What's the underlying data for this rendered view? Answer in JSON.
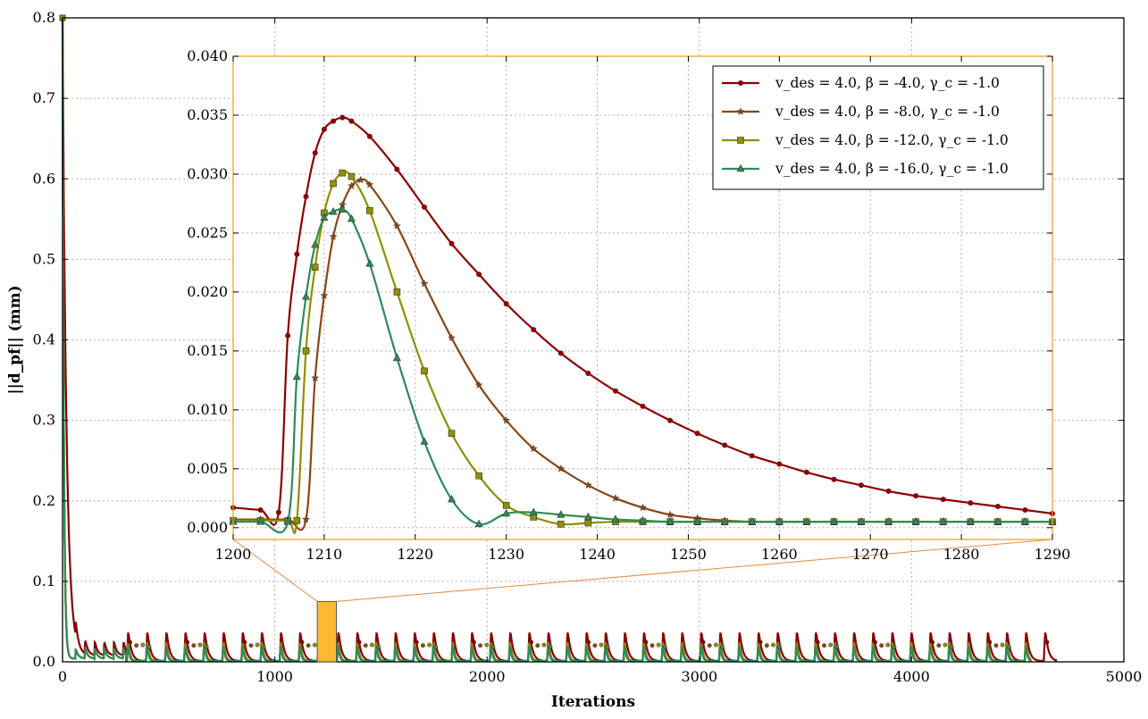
{
  "chart_data": [
    {
      "id": "main",
      "type": "line",
      "title": "",
      "xlabel": "Iterations",
      "ylabel": "||d_pf|| (mm)",
      "xlim": [
        0,
        5000
      ],
      "ylim": [
        0,
        0.8
      ],
      "xticks": [
        "0",
        "1000",
        "2000",
        "3000",
        "4000",
        "5000"
      ],
      "yticks": [
        "0.0",
        "0.1",
        "0.2",
        "0.3",
        "0.4",
        "0.5",
        "0.6",
        "0.7",
        "0.8"
      ],
      "grid": true,
      "initial_value": 0.8,
      "spike_period_iterations": 90,
      "spike_heights": {
        "beta_-4": 0.035,
        "beta_-8": 0.029,
        "beta_-12": 0.03,
        "beta_-16": 0.027
      },
      "zoom_region": {
        "x": [
          1200,
          1290
        ],
        "y": [
          0,
          0.075
        ]
      },
      "series": [
        {
          "name": "v_des = 4.0, β = -4.0, γ_c = -1.0",
          "color": "#8b0000",
          "last_iteration": 4680
        },
        {
          "name": "v_des = 4.0, β = -8.0, γ_c = -1.0",
          "color": "#8b4513",
          "last_iteration": 4560
        },
        {
          "name": "v_des = 4.0, β = -12.0, γ_c = -1.0",
          "color": "#8f8f00",
          "last_iteration": 4560
        },
        {
          "name": "v_des = 4.0, β = -16.0, γ_c = -1.0",
          "color": "#2e8b57",
          "last_iteration": 4560
        }
      ]
    },
    {
      "id": "inset",
      "type": "line",
      "title": "",
      "xlabel": "",
      "ylabel": "",
      "xlim": [
        1200,
        1290
      ],
      "ylim": [
        -0.001,
        0.04
      ],
      "xticks": [
        "1200",
        "1210",
        "1220",
        "1230",
        "1240",
        "1250",
        "1260",
        "1270",
        "1280",
        "1290"
      ],
      "yticks": [
        "0.000",
        "0.005",
        "0.010",
        "0.015",
        "0.020",
        "0.025",
        "0.030",
        "0.035",
        "0.040"
      ],
      "grid": true,
      "legend": "top-right",
      "series": [
        {
          "name": "v_des = 4.0, β = -4.0, γ_c = -1.0",
          "color": "#8b0000",
          "marker": "circle",
          "x": [
            1200,
            1203,
            1205,
            1206,
            1207,
            1208,
            1209,
            1210,
            1211,
            1212,
            1213,
            1215,
            1218,
            1221,
            1224,
            1227,
            1230,
            1233,
            1236,
            1239,
            1242,
            1245,
            1248,
            1251,
            1254,
            1257,
            1260,
            1263,
            1266,
            1269,
            1272,
            1275,
            1278,
            1281,
            1284,
            1287,
            1290
          ],
          "y": [
            0.0017,
            0.0015,
            0.0013,
            0.0163,
            0.0232,
            0.0281,
            0.0318,
            0.0338,
            0.0345,
            0.0348,
            0.0345,
            0.0332,
            0.0304,
            0.0272,
            0.0241,
            0.0215,
            0.019,
            0.0168,
            0.0148,
            0.0131,
            0.0116,
            0.0103,
            0.0091,
            0.008,
            0.007,
            0.0061,
            0.0054,
            0.0047,
            0.0041,
            0.0036,
            0.0031,
            0.0027,
            0.0024,
            0.0021,
            0.0018,
            0.0015,
            0.0012
          ]
        },
        {
          "name": "v_des = 4.0, β = -8.0, γ_c = -1.0",
          "color": "#8b4513",
          "marker": "star",
          "x": [
            1200,
            1203,
            1206,
            1208,
            1209,
            1210,
            1211,
            1212,
            1213,
            1214,
            1215,
            1218,
            1221,
            1224,
            1227,
            1230,
            1233,
            1236,
            1239,
            1242,
            1245,
            1248,
            1251,
            1254,
            1257,
            1260,
            1263,
            1266,
            1269,
            1272,
            1275,
            1278,
            1281,
            1284,
            1287,
            1290
          ],
          "y": [
            0.0007,
            0.0007,
            0.0007,
            0.0007,
            0.0127,
            0.0197,
            0.0247,
            0.0274,
            0.029,
            0.0295,
            0.0291,
            0.0256,
            0.0207,
            0.0161,
            0.0121,
            0.0091,
            0.0067,
            0.005,
            0.0036,
            0.0025,
            0.0017,
            0.0011,
            0.0008,
            0.0006,
            0.0005,
            0.0005,
            0.0005,
            0.0005,
            0.0005,
            0.0005,
            0.0005,
            0.0005,
            0.0005,
            0.0005,
            0.0005,
            0.0005
          ]
        },
        {
          "name": "v_des = 4.0, β = -12.0, γ_c = -1.0",
          "color": "#8f8f00",
          "marker": "square",
          "x": [
            1200,
            1203,
            1206,
            1207,
            1208,
            1209,
            1210,
            1211,
            1212,
            1213,
            1215,
            1218,
            1221,
            1224,
            1227,
            1230,
            1233,
            1236,
            1239,
            1242,
            1245,
            1248,
            1251,
            1254,
            1257,
            1260,
            1263,
            1266,
            1269,
            1272,
            1275,
            1278,
            1281,
            1284,
            1287,
            1290
          ],
          "y": [
            0.0006,
            0.0006,
            0.0006,
            0.0006,
            0.015,
            0.0221,
            0.0267,
            0.0292,
            0.0301,
            0.0298,
            0.0269,
            0.02,
            0.0133,
            0.008,
            0.0044,
            0.0019,
            0.0009,
            0.0003,
            0.0004,
            0.0005,
            0.0005,
            0.0005,
            0.0005,
            0.0005,
            0.0005,
            0.0005,
            0.0005,
            0.0005,
            0.0005,
            0.0005,
            0.0005,
            0.0005,
            0.0005,
            0.0005,
            0.0005,
            0.0005
          ]
        },
        {
          "name": "v_des = 4.0, β = -16.0, γ_c = -1.0",
          "color": "#2e8b57",
          "marker": "triangle",
          "x": [
            1200,
            1203,
            1206,
            1207,
            1208,
            1209,
            1210,
            1211,
            1212,
            1213,
            1215,
            1218,
            1221,
            1224,
            1227,
            1230,
            1233,
            1236,
            1239,
            1242,
            1245,
            1248,
            1251,
            1254,
            1257,
            1260,
            1263,
            1266,
            1269,
            1272,
            1275,
            1278,
            1281,
            1284,
            1287,
            1290
          ],
          "y": [
            0.0005,
            0.0005,
            0.0005,
            0.0128,
            0.0196,
            0.024,
            0.0263,
            0.0268,
            0.027,
            0.0262,
            0.0224,
            0.0144,
            0.0073,
            0.0024,
            0.0003,
            0.0012,
            0.0013,
            0.0011,
            0.0009,
            0.0007,
            0.0006,
            0.0005,
            0.0005,
            0.0005,
            0.0005,
            0.0005,
            0.0005,
            0.0005,
            0.0005,
            0.0005,
            0.0005,
            0.0005,
            0.0005,
            0.0005,
            0.0005,
            0.0005
          ]
        }
      ]
    }
  ]
}
